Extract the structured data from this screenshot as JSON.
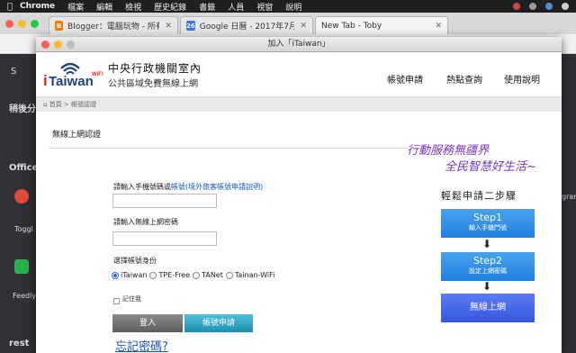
{
  "menubar": {
    "app": "Chrome",
    "items": [
      "檔案",
      "編輯",
      "檢視",
      "歷史紀錄",
      "書籤",
      "人員",
      "視窗",
      "說明"
    ]
  },
  "tabs": [
    {
      "title": "Blogger：電腦玩物 - 所有文章",
      "icon": "blogger-icon",
      "color": "#f57d00"
    },
    {
      "title": "Google 日曆 - 2017年7月17日",
      "icon": "calendar-icon",
      "color": "#3b78e7"
    },
    {
      "title": "New Tab - Toby",
      "icon": "",
      "color": ""
    }
  ],
  "background_page": {
    "left_texts": [
      "稍後分",
      "Office",
      "Toggl",
      "Feedly",
      "rest"
    ],
    "right_text": "gram"
  },
  "popup": {
    "window_title": "加入「iTaiwan」",
    "logo_text": "iTaiwan",
    "logo_wifi": "WiFi",
    "brand_line1": "中央行政機關室內",
    "brand_line2": "公共區域免費無線上網",
    "nav": [
      "帳號申請",
      "熱點查詢",
      "使用說明"
    ],
    "breadcrumb": "首頁 > 帳號認證",
    "section_title": "無線上網認證",
    "phone_label": "請輸入手機號碼或",
    "phone_link": "帳號(境外旅客帳號申請說明)",
    "password_label": "請輸入無線上網密碼",
    "phone_value": "",
    "password_value": "",
    "identity_label": "選擇帳號身份",
    "identities": [
      "iTaiwan",
      "TPE-Free",
      "TANet",
      "Tainan-WiFi"
    ],
    "selected_identity": "iTaiwan",
    "remember_label": "記住我",
    "login_button": "登入",
    "register_button": "帳號申請",
    "forgot_link": "忘記密碼?",
    "slogan1": "行動服務無疆界",
    "slogan2": "全民智慧好生活~",
    "steps_title": "輕鬆申請二步驟",
    "step1_title": "Step1",
    "step1_sub": "輸入手機門號",
    "step2_title": "Step2",
    "step2_sub": "設定上網密碼",
    "final_step": "無線上網"
  }
}
